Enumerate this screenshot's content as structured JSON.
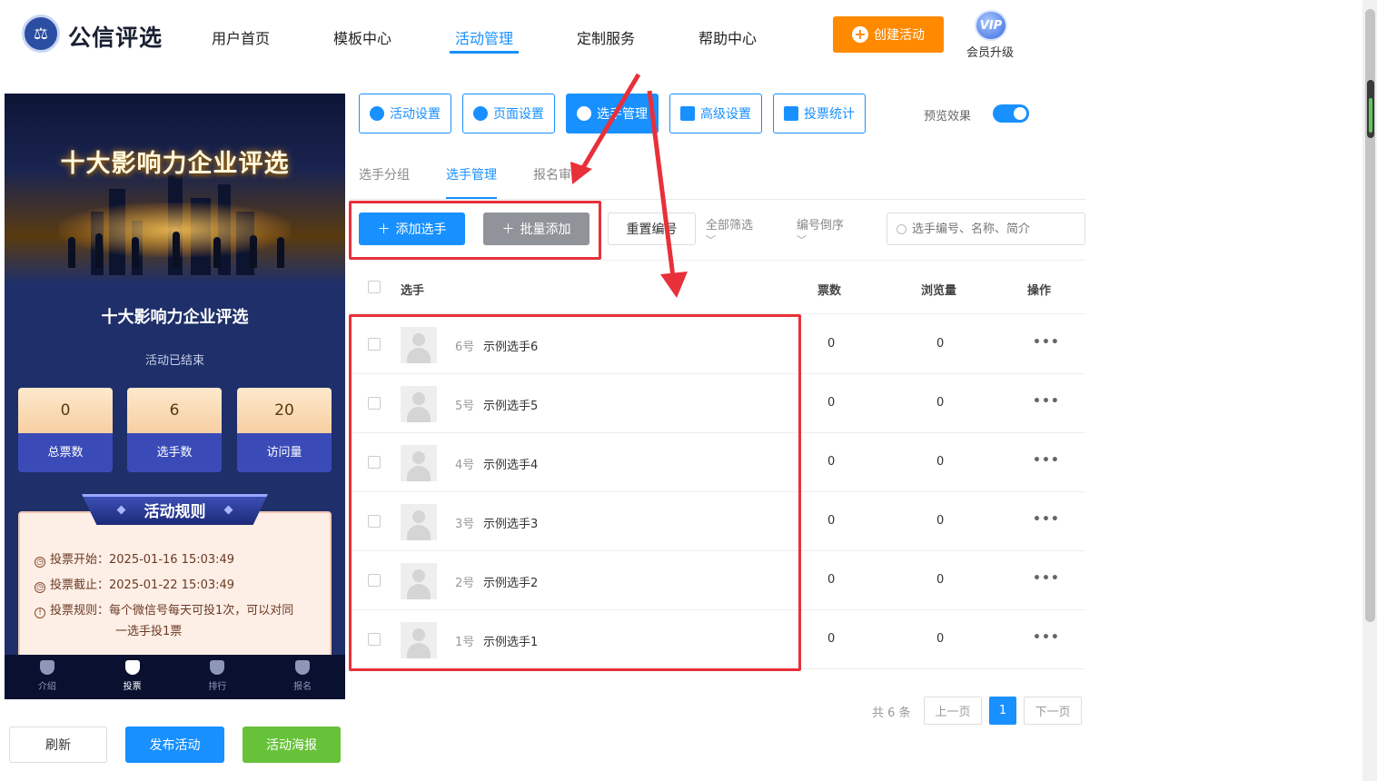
{
  "brand": {
    "name": "公信评选",
    "logo_icon": "scales-icon"
  },
  "nav": {
    "items": [
      {
        "label": "用户首页"
      },
      {
        "label": "模板中心"
      },
      {
        "label": "活动管理"
      },
      {
        "label": "定制服务"
      },
      {
        "label": "帮助中心"
      }
    ],
    "active_index": 2,
    "create_label": "创建活动",
    "vip_badge": "VIP",
    "vip_label": "会员升级"
  },
  "preview": {
    "banner_title": "十大影响力企业评选",
    "title": "十大影响力企业评选",
    "status": "活动已结束",
    "stats": [
      {
        "value": "0",
        "label": "总票数"
      },
      {
        "value": "6",
        "label": "选手数"
      },
      {
        "value": "20",
        "label": "访问量"
      }
    ],
    "rules_title": "活动规则",
    "rules": {
      "start": "投票开始：2025-01-16 15:03:49",
      "end": "投票截止：2025-01-22 15:03:49",
      "rule_line1": "投票规则：每个微信号每天可投1次，可以对同",
      "rule_line2": "一选手投1票"
    },
    "tabs": [
      {
        "label": "介绍"
      },
      {
        "label": "投票"
      },
      {
        "label": "排行"
      },
      {
        "label": "报名"
      }
    ],
    "active_tab": 1
  },
  "bottom_buttons": {
    "refresh": "刷新",
    "publish": "发布活动",
    "poster": "活动海报"
  },
  "toolbar": {
    "buttons": [
      {
        "label": "活动设置",
        "icon": "star-icon"
      },
      {
        "label": "页面设置",
        "icon": "gear-icon"
      },
      {
        "label": "选手管理",
        "icon": "users-icon"
      },
      {
        "label": "高级设置",
        "icon": "settings-sliders-icon"
      },
      {
        "label": "投票统计",
        "icon": "bar-chart-icon"
      }
    ],
    "active_index": 2,
    "preview_label": "预览效果",
    "preview_on": true
  },
  "subtabs": {
    "items": [
      {
        "label": "选手分组"
      },
      {
        "label": "选手管理"
      },
      {
        "label": "报名审核"
      }
    ],
    "active_index": 1
  },
  "actions": {
    "add": "添加选手",
    "batch_add": "批量添加",
    "reset": "重置编号",
    "filter": "全部筛选",
    "sort": "编号倒序",
    "search_placeholder": "选手编号、名称、简介"
  },
  "table": {
    "headers": {
      "player": "选手",
      "votes": "票数",
      "views": "浏览量",
      "ops": "操作"
    },
    "rows": [
      {
        "num": "6号",
        "name": "示例选手6",
        "votes": "0",
        "views": "0",
        "ops": "•••"
      },
      {
        "num": "5号",
        "name": "示例选手5",
        "votes": "0",
        "views": "0",
        "ops": "•••"
      },
      {
        "num": "4号",
        "name": "示例选手4",
        "votes": "0",
        "views": "0",
        "ops": "•••"
      },
      {
        "num": "3号",
        "name": "示例选手3",
        "votes": "0",
        "views": "0",
        "ops": "•••"
      },
      {
        "num": "2号",
        "name": "示例选手2",
        "votes": "0",
        "views": "0",
        "ops": "•••"
      },
      {
        "num": "1号",
        "name": "示例选手1",
        "votes": "0",
        "views": "0",
        "ops": "•••"
      }
    ]
  },
  "pager": {
    "total": "共 6 条",
    "prev": "上一页",
    "current": "1",
    "next": "下一页"
  },
  "colors": {
    "accent": "#1890ff",
    "orange": "#ff8a00",
    "green": "#67c23a",
    "annotation": "#e8303a"
  }
}
